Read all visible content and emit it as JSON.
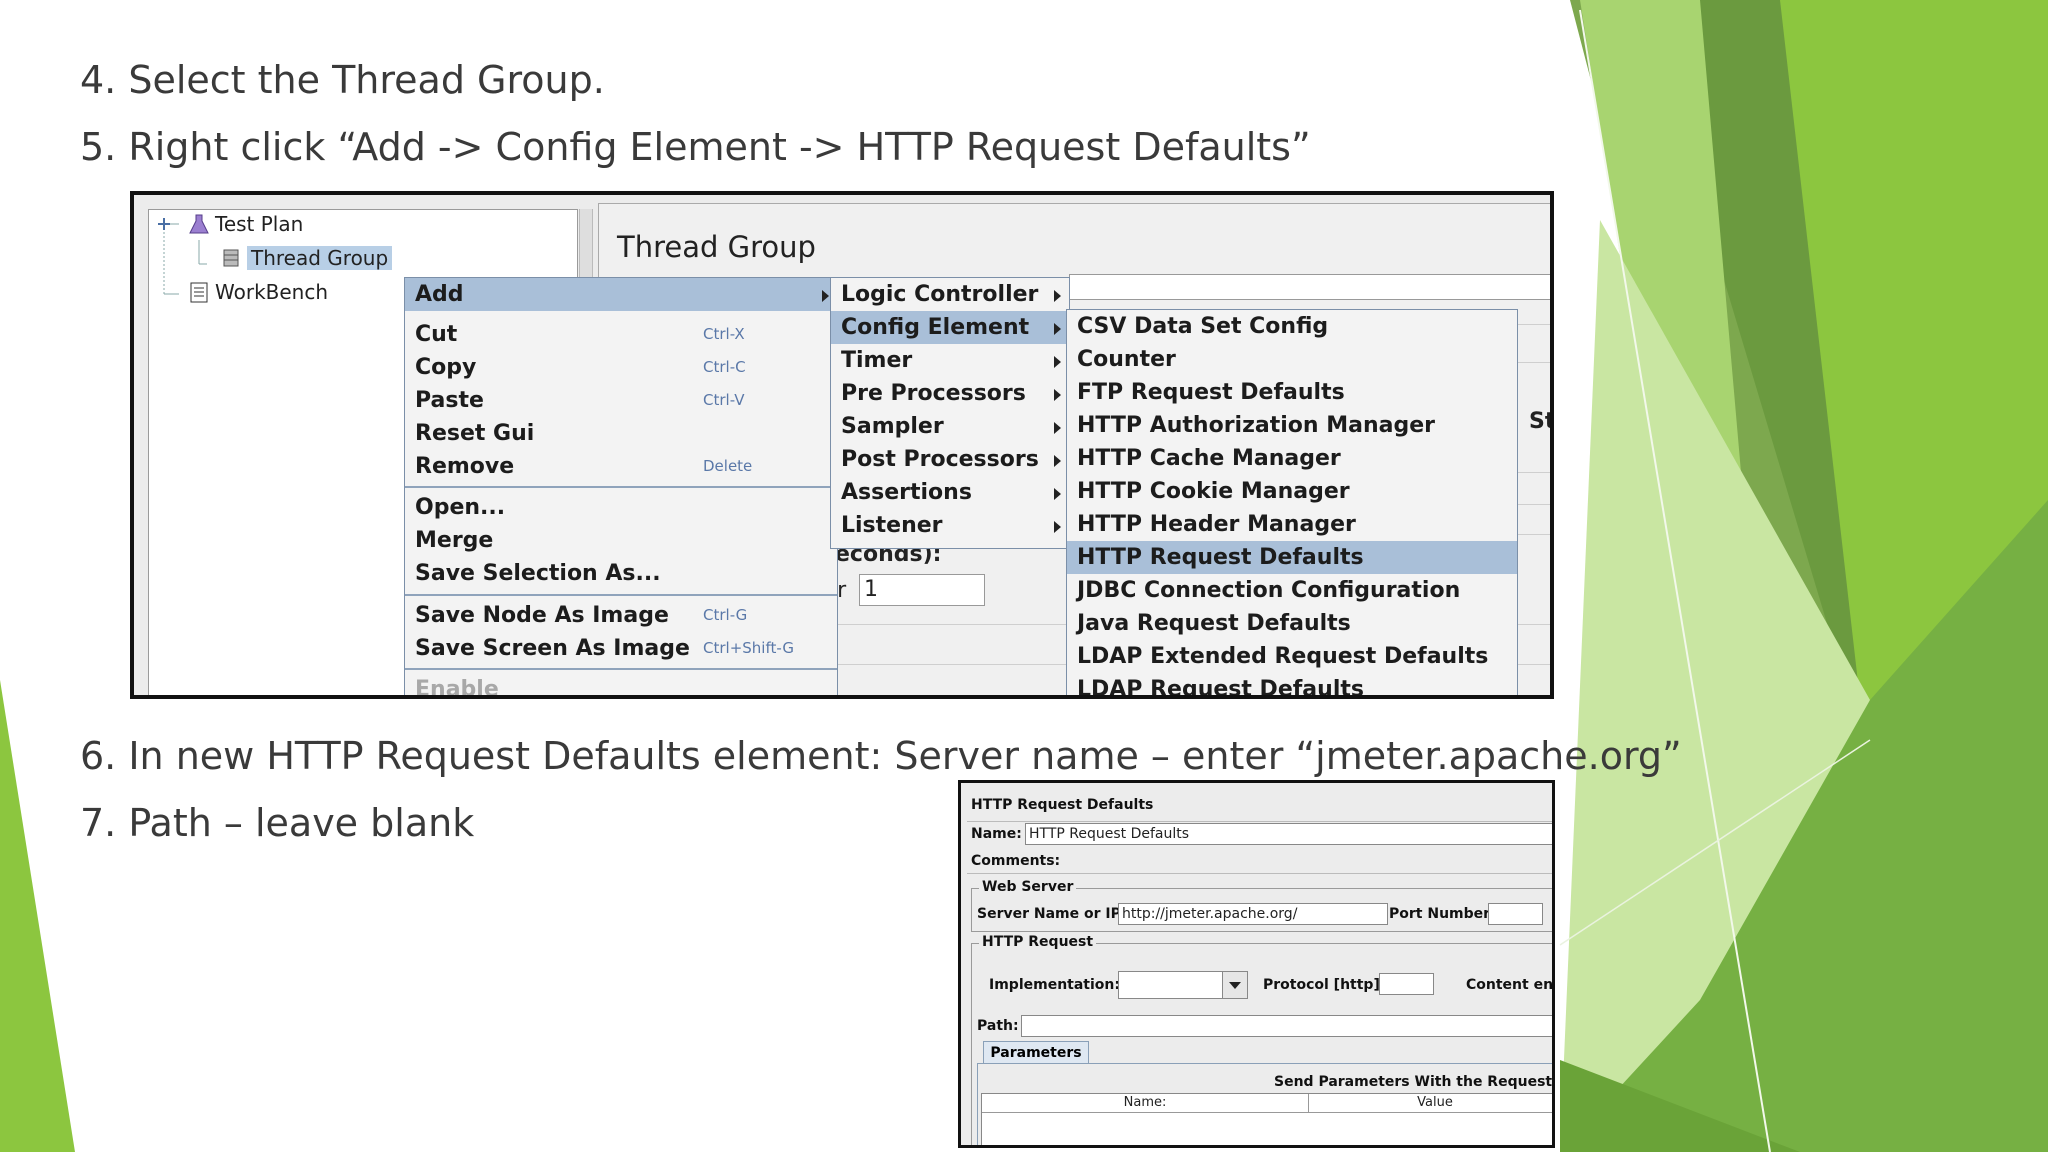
{
  "steps": [
    "4. Select the Thread Group.",
    "5. Right click “Add -> Config Element -> HTTP Request Defaults”",
    "6. In new HTTP Request Defaults element: Server name – enter “jmeter.apache.org”",
    "7. Path – leave blank"
  ],
  "colors": {
    "green_dark": "#5e9a3b",
    "green_mid": "#8cc63f",
    "green_light": "#c5e39a",
    "menu_highlight": "#a9bfd8",
    "shortcut_blue": "#5a78a8"
  },
  "screenshot1": {
    "tree": {
      "items": [
        {
          "label": "Test Plan",
          "icon": "flask-icon"
        },
        {
          "label": "Thread Group",
          "icon": "spool-icon",
          "selected": true
        },
        {
          "label": "WorkBench",
          "icon": "clipboard-icon"
        }
      ]
    },
    "panel_title": "Thread Group",
    "panel_fragments": {
      "right_cut": "St",
      "seconds": "(in seconds):",
      "seconds_value": "1",
      "forever": "orever",
      "forever_value": "1"
    },
    "context_menu": {
      "add": "Add",
      "items": [
        {
          "label": "Cut",
          "shortcut": "Ctrl-X"
        },
        {
          "label": "Copy",
          "shortcut": "Ctrl-C"
        },
        {
          "label": "Paste",
          "shortcut": "Ctrl-V"
        },
        {
          "label": "Reset Gui",
          "shortcut": ""
        },
        {
          "label": "Remove",
          "shortcut": "Delete"
        }
      ],
      "items2": [
        {
          "label": "Open...",
          "shortcut": ""
        },
        {
          "label": "Merge",
          "shortcut": ""
        },
        {
          "label": "Save Selection As...",
          "shortcut": ""
        }
      ],
      "items3": [
        {
          "label": "Save Node As Image",
          "shortcut": "Ctrl-G"
        },
        {
          "label": "Save Screen As Image",
          "shortcut": "Ctrl+Shift-G"
        }
      ],
      "enable": "Enable"
    },
    "add_submenu": [
      "Logic Controller",
      "Config Element",
      "Timer",
      "Pre Processors",
      "Sampler",
      "Post Processors",
      "Assertions",
      "Listener"
    ],
    "config_submenu": [
      "CSV Data Set Config",
      "Counter",
      "FTP Request Defaults",
      "HTTP Authorization Manager",
      "HTTP Cache Manager",
      "HTTP Cookie Manager",
      "HTTP Header Manager",
      "HTTP Request Defaults",
      "JDBC Connection Configuration",
      "Java Request Defaults",
      "LDAP Extended Request Defaults",
      "LDAP Request Defaults"
    ]
  },
  "screenshot2": {
    "title": "HTTP Request Defaults",
    "name_label": "Name:",
    "name_value": "HTTP Request Defaults",
    "comments_label": "Comments:",
    "web_server_legend": "Web Server",
    "server_label": "Server Name or IP:",
    "server_value": "http://jmeter.apache.org/",
    "port_label": "Port Number:",
    "http_request_legend": "HTTP Request",
    "implementation_label": "Implementation:",
    "protocol_label": "Protocol [http]:",
    "content_label": "Content enc",
    "path_label": "Path:",
    "parameters_tab": "Parameters",
    "send_params_label": "Send Parameters With the Request:",
    "col_name": "Name:",
    "col_value": "Value"
  }
}
